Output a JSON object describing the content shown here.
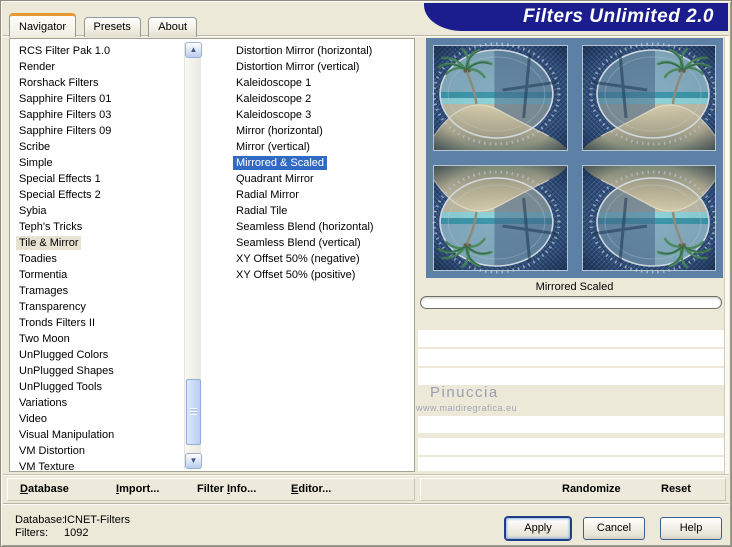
{
  "window": {
    "title": "Filters Unlimited 2.0"
  },
  "tabs": [
    {
      "label": "Navigator",
      "active": true
    },
    {
      "label": "Presets",
      "active": false
    },
    {
      "label": "About",
      "active": false
    }
  ],
  "category_list": {
    "items": [
      "RCS Filter Pak 1.0",
      "Render",
      "Rorshack Filters",
      "Sapphire Filters 01",
      "Sapphire Filters 03",
      "Sapphire Filters 09",
      "Scribe",
      "Simple",
      "Special Effects 1",
      "Special Effects 2",
      "Sybia",
      "Teph's Tricks",
      "Tile & Mirror",
      "Toadies",
      "Tormentia",
      "Tramages",
      "Transparency",
      "Tronds Filters II",
      "Two Moon",
      "UnPlugged Colors",
      "UnPlugged Shapes",
      "UnPlugged Tools",
      "Variations",
      "Video",
      "Visual Manipulation",
      "VM Distortion",
      "VM Texture"
    ],
    "selected": "Tile & Mirror"
  },
  "filter_list": {
    "items": [
      "Distortion Mirror (horizontal)",
      "Distortion Mirror (vertical)",
      "Kaleidoscope 1",
      "Kaleidoscope 2",
      "Kaleidoscope 3",
      "Mirror (horizontal)",
      "Mirror (vertical)",
      "Mirrored & Scaled",
      "Quadrant Mirror",
      "Radial Mirror",
      "Radial Tile",
      "Seamless Blend (horizontal)",
      "Seamless Blend (vertical)",
      "XY Offset 50% (negative)",
      "XY Offset 50% (positive)"
    ],
    "selected": "Mirrored & Scaled"
  },
  "preview": {
    "selected_filter_label": "Mirrored  Scaled"
  },
  "watermark": {
    "author": "Pinuccia",
    "site": "www.maidiregrafica.eu"
  },
  "toolbar": {
    "left": [
      {
        "label": "Database",
        "underline": 0
      },
      {
        "label": "Import...",
        "underline": 0
      },
      {
        "label": "Filter Info...",
        "underline": 7
      },
      {
        "label": "Editor...",
        "underline": 0
      }
    ],
    "right": [
      {
        "label": "Randomize"
      },
      {
        "label": "Reset"
      }
    ]
  },
  "status": {
    "database_label": "Database:",
    "database_value": "ICNET-Filters",
    "filters_label": "Filters:",
    "filters_value": "1092"
  },
  "action_buttons": [
    {
      "label": "Apply",
      "default": true
    },
    {
      "label": "Cancel",
      "default": false
    },
    {
      "label": "Help",
      "default": false
    }
  ],
  "scrollbar": {
    "up_arrow": "▲",
    "down_arrow": "▼"
  },
  "colors": {
    "dialog_bg": "#ECE9D8",
    "banner_bg": "#1B1C8E",
    "selection_blue": "#316AC5",
    "inactive_selection": "#E7E3D3",
    "preview_margin": "#5C80A6",
    "preview_inner": "#2F4E7C",
    "tab_accent_orange": "#E9972F"
  }
}
